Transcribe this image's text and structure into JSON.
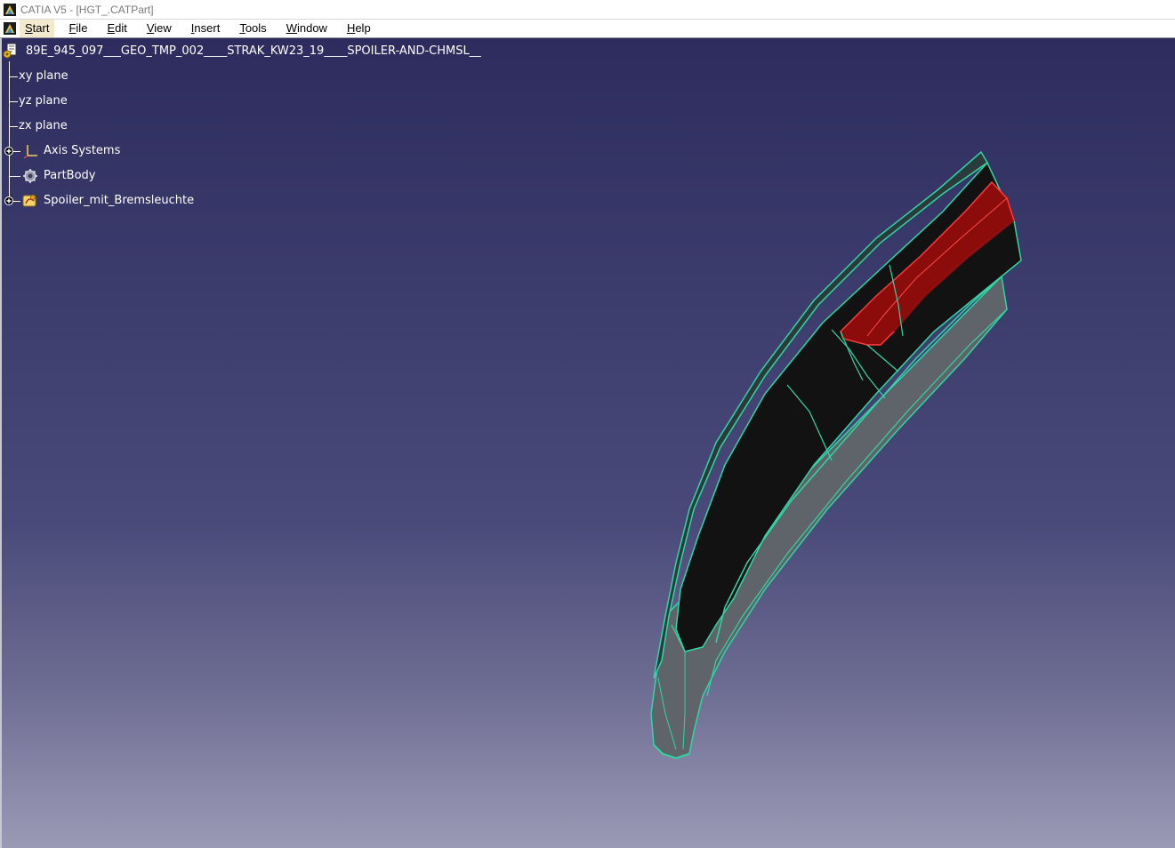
{
  "window": {
    "title": "CATIA V5 - [HGT_.CATPart]"
  },
  "menu": {
    "items": [
      {
        "first": "S",
        "rest": "tart",
        "active": true
      },
      {
        "first": "F",
        "rest": "ile",
        "active": false
      },
      {
        "first": "E",
        "rest": "dit",
        "active": false
      },
      {
        "first": "V",
        "rest": "iew",
        "active": false
      },
      {
        "first": "I",
        "rest": "nsert",
        "active": false
      },
      {
        "first": "T",
        "rest": "ools",
        "active": false
      },
      {
        "first": "W",
        "rest": "indow",
        "active": false
      },
      {
        "first": "H",
        "rest": "elp",
        "active": false
      }
    ]
  },
  "tree": {
    "root": "89E_945_097___GEO_TMP_002____STRAK_KW23_19____SPOILER-AND-CHMSL__",
    "nodes": [
      {
        "label": "xy plane"
      },
      {
        "label": "yz plane"
      },
      {
        "label": "zx plane"
      },
      {
        "label": "Axis Systems"
      },
      {
        "label": "PartBody"
      },
      {
        "label": "Spoiler_mit_Bremsleuchte"
      }
    ]
  },
  "colors": {
    "edge": "#31d6a4",
    "surface": "#121212",
    "brake_light": "#9c1010",
    "brake_light_edge": "#ff3030",
    "underside": "#6b6f74"
  }
}
